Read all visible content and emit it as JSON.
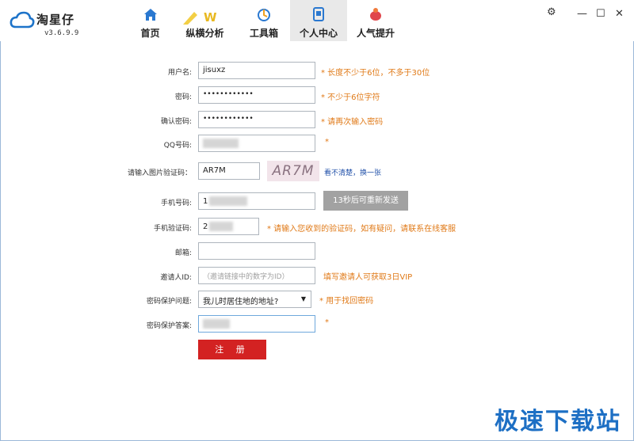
{
  "app": {
    "name": "淘星仔",
    "version": "v3.6.9.9"
  },
  "nav": [
    {
      "label": "首页",
      "icon": "home-icon",
      "active": false
    },
    {
      "label": "纵横分析",
      "icon": "analysis-icon",
      "active": false
    },
    {
      "label": "工具箱",
      "icon": "toolbox-icon",
      "active": false
    },
    {
      "label": "个人中心",
      "icon": "user-center-icon",
      "active": true
    },
    {
      "label": "人气提升",
      "icon": "popularity-icon",
      "active": false
    }
  ],
  "window": {
    "settings": "⚙",
    "minimize": "—",
    "maximize": "☐",
    "close": "✕"
  },
  "form": {
    "username": {
      "label": "用户名:",
      "value": "jisuxz",
      "hint": "* 长度不少于6位，不多于30位"
    },
    "password": {
      "label": "密码:",
      "value": "••••••••••••",
      "hint": "* 不少于6位字符"
    },
    "confirm_password": {
      "label": "确认密码:",
      "value": "••••••••••••",
      "hint": "* 请再次输入密码"
    },
    "qq": {
      "label": "QQ号码:",
      "hint": "*"
    },
    "captcha": {
      "label": "请输入图片验证码：",
      "value": "AR7M",
      "image_text": "AR7M",
      "refresh": "看不清楚，换一张"
    },
    "phone": {
      "label": "手机号码:",
      "value": "1",
      "resend": "13秒后可重新发送"
    },
    "sms_code": {
      "label": "手机验证码:",
      "value": "2",
      "hint": "* 请输入您收到的验证码，如有疑问，请联系在线客服"
    },
    "email": {
      "label": "邮箱:"
    },
    "inviter": {
      "label": "邀请人ID:",
      "placeholder": "（邀请链接中的数字为ID）",
      "hint": "填写邀请人可获取3日VIP"
    },
    "security_question": {
      "label": "密码保护问题:",
      "value": "我儿时居住地的地址?",
      "hint": "* 用于找回密码"
    },
    "security_answer": {
      "label": "密码保护答案:",
      "hint": "*"
    },
    "submit": "注 册"
  },
  "watermark": "极速下载站",
  "colors": {
    "accent_red": "#d32222",
    "hint_orange": "#e07a18",
    "link_blue": "#1f4fa8",
    "logo_blue": "#1d6fc4"
  }
}
